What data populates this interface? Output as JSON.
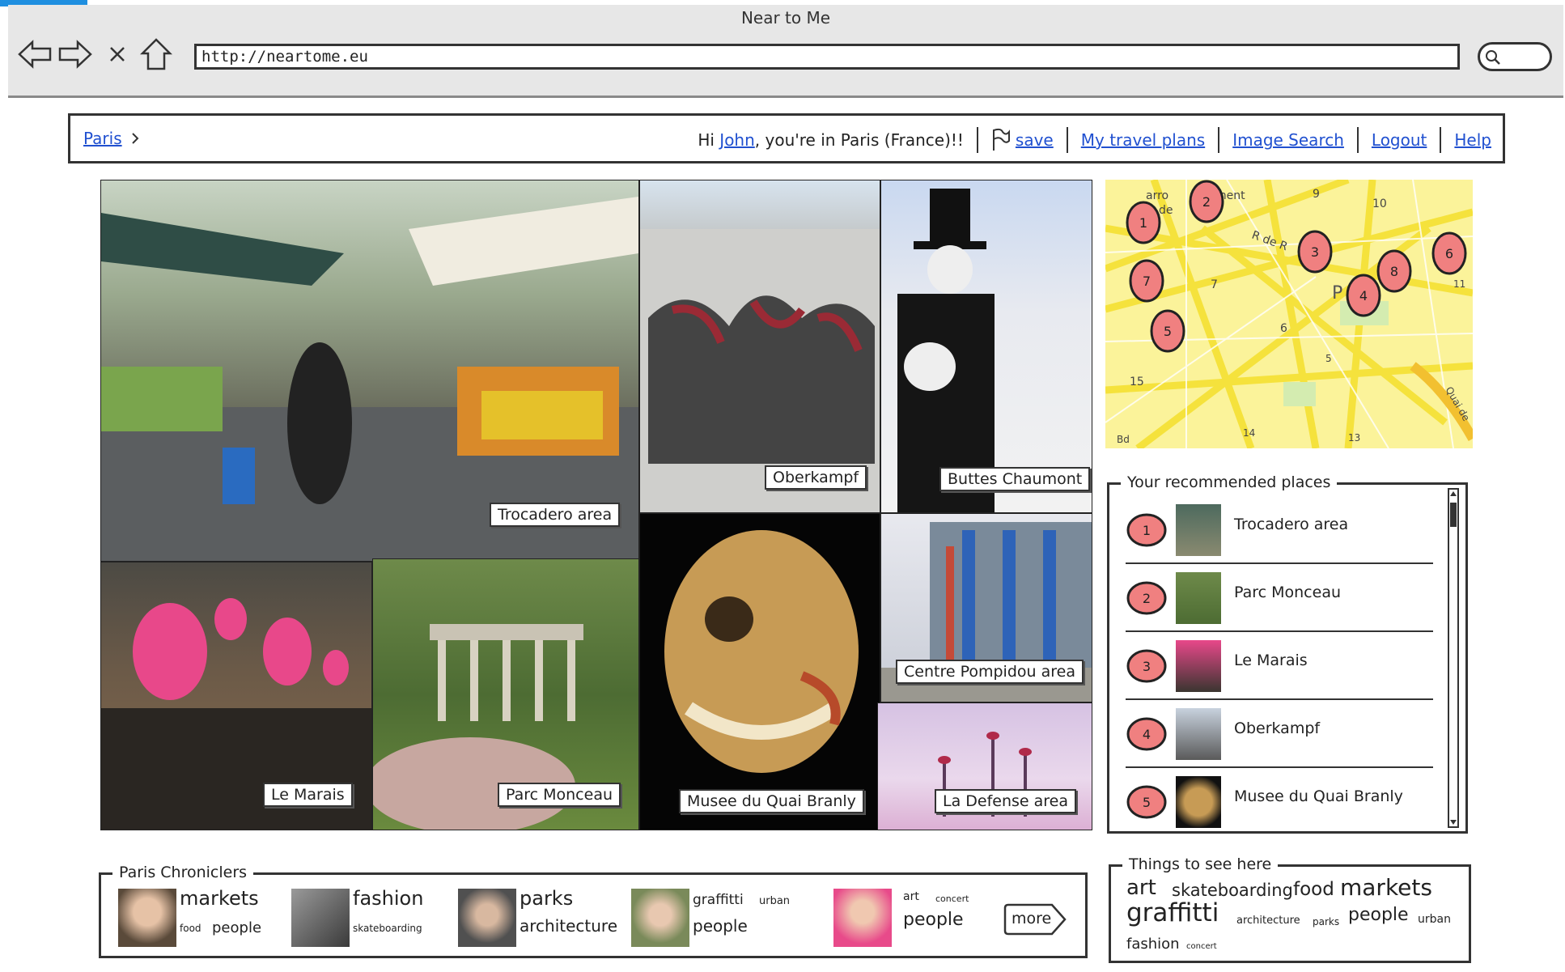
{
  "browser": {
    "title": "Near to Me",
    "url": "http://neartome.eu"
  },
  "nav": {
    "breadcrumb": "Paris",
    "greeting_prefix": "Hi",
    "user": "John",
    "greeting_suffix": ", you're in Paris (France)!!",
    "save": "save",
    "travel_plans": "My travel plans",
    "image_search": "Image Search",
    "logout": "Logout",
    "help": "Help"
  },
  "photos": [
    {
      "caption": "Trocadero area"
    },
    {
      "caption": "Oberkampf"
    },
    {
      "caption": "Buttes Chaumont"
    },
    {
      "caption": "Le Marais"
    },
    {
      "caption": "Parc Monceau"
    },
    {
      "caption": "Musee du Quai Branly"
    },
    {
      "caption": "Centre Pompidou area"
    },
    {
      "caption": "La Defense area"
    }
  ],
  "map": {
    "labels": [
      "arro",
      "ment",
      "de",
      "9",
      "10",
      "R de R",
      "7",
      "P",
      "6",
      "5",
      "15",
      "14",
      "13",
      "11",
      "Quai de",
      "Bd"
    ],
    "pins": [
      "1",
      "2",
      "3",
      "4",
      "5",
      "6",
      "7",
      "8"
    ]
  },
  "recommended": {
    "title": "Your recommended places",
    "items": [
      {
        "num": "1",
        "name": "Trocadero area"
      },
      {
        "num": "2",
        "name": "Parc Monceau"
      },
      {
        "num": "3",
        "name": "Le Marais"
      },
      {
        "num": "4",
        "name": "Oberkampf"
      },
      {
        "num": "5",
        "name": "Musee du Quai Branly"
      }
    ]
  },
  "chroniclers": {
    "title": "Paris Chroniclers",
    "people": [
      {
        "tags": [
          "markets",
          "food",
          "people"
        ]
      },
      {
        "tags": [
          "fashion",
          "skateboarding"
        ]
      },
      {
        "tags": [
          "parks",
          "architecture"
        ]
      },
      {
        "tags": [
          "graffitti",
          "urban",
          "people"
        ]
      },
      {
        "tags": [
          "art",
          "concert",
          "people"
        ]
      }
    ],
    "more": "more"
  },
  "things": {
    "title": "Things to see here",
    "tags": [
      "art",
      "skateboarding",
      "food",
      "markets",
      "graffitti",
      "architecture",
      "parks",
      "people",
      "urban",
      "fashion",
      "concert"
    ]
  },
  "colors": {
    "link": "#2050d0",
    "map_bg": "#fbf39a",
    "map_road": "#f5e23c",
    "pin_fill": "#f08080",
    "border": "#333333"
  }
}
